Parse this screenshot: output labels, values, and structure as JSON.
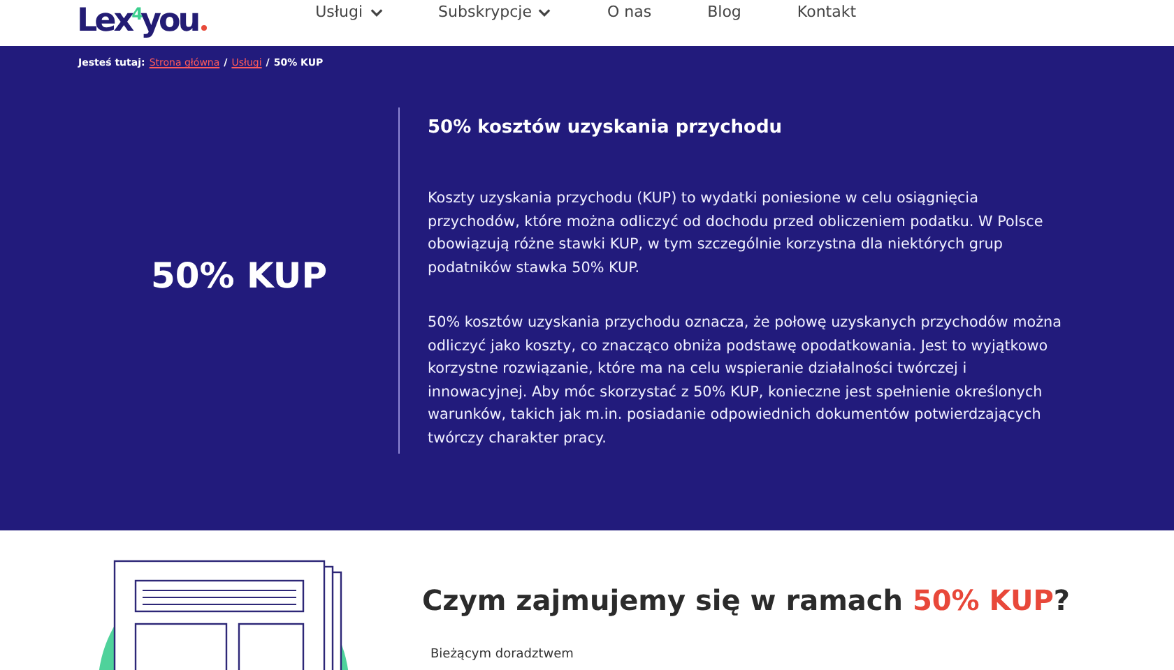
{
  "header": {
    "logo": {
      "part_1": "Lex",
      "part_2": "4",
      "part_3": "you"
    },
    "nav": [
      {
        "label": "Usługi",
        "dropdown": true
      },
      {
        "label": "Subskrypcje",
        "dropdown": true
      },
      {
        "label": "O nas",
        "dropdown": false
      },
      {
        "label": "Blog",
        "dropdown": false
      },
      {
        "label": "Kontakt",
        "dropdown": false
      }
    ]
  },
  "hero": {
    "breadcrumb": {
      "prefix": "Jesteś tutaj:",
      "links": [
        "Strona główna",
        "Usługi"
      ],
      "separator": "/",
      "current": "50% KUP"
    },
    "title": "50% KUP",
    "subtitle": "50% kosztów uzyskania przychodu",
    "paragraphs": [
      "Koszty uzyskania przychodu (KUP) to wydatki poniesione w celu osiągnięcia przychodów, które można odliczyć od dochodu przed obliczeniem podatku. W Polsce obowiązują różne stawki KUP, w tym szczególnie korzystna dla niektórych grup podatników stawka 50% KUP.",
      "50% kosztów uzyskania przychodu oznacza, że połowę uzyskanych przychodów można odliczyć jako koszty, co znacząco obniża podstawę opodatkowania. Jest to wyjątkowo korzystne rozwiązanie, które ma na celu wspieranie działalności twórczej i innowacyjnej. Aby móc skorzystać z 50% KUP, konieczne jest spełnienie określonych warunków, takich jak m.in. posiadanie odpowiednich dokumentów potwierdzających twórczy charakter pracy."
    ]
  },
  "services": {
    "heading": {
      "prefix": "Czym zajmujemy się w ramach ",
      "highlight": "50% KUP",
      "suffix": "?"
    },
    "items": [
      "Bieżącym doradztwem"
    ]
  }
}
